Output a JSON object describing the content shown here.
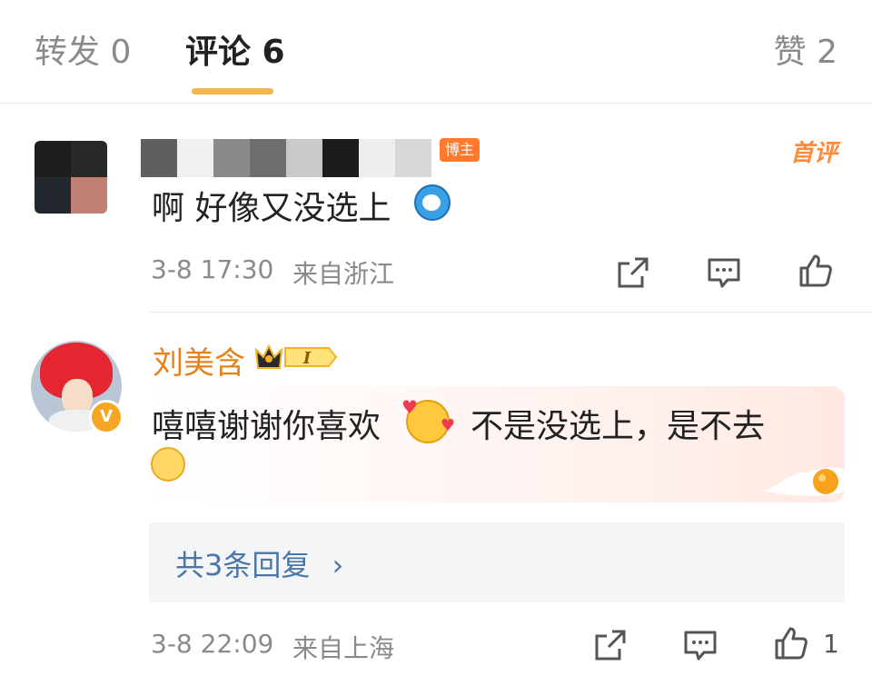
{
  "tabs": {
    "repost": "转发 0",
    "comments": "评论 6",
    "likes": "赞 2"
  },
  "accent_color": "#f5b74a",
  "comments": [
    {
      "author_badge": "博主",
      "first_comment_label": "首评",
      "text": "啊 好像又没选上",
      "emoji": "doraemon-emoji",
      "time": "3-8 17:30",
      "location": "来自浙江"
    },
    {
      "author": "刘美含",
      "level_badge": "I",
      "verified_badge": "V",
      "text_line1": "嘻嘻谢谢你喜欢",
      "text_line1_after": "不是没选上，是不去",
      "emoji1": "smiling-face-with-hearts-emoji",
      "emoji2": "thinking-face-emoji",
      "replies_label": "共3条回复",
      "replies_chevron": "›",
      "time": "3-8 22:09",
      "location": "来自上海",
      "like_count": "1"
    }
  ]
}
